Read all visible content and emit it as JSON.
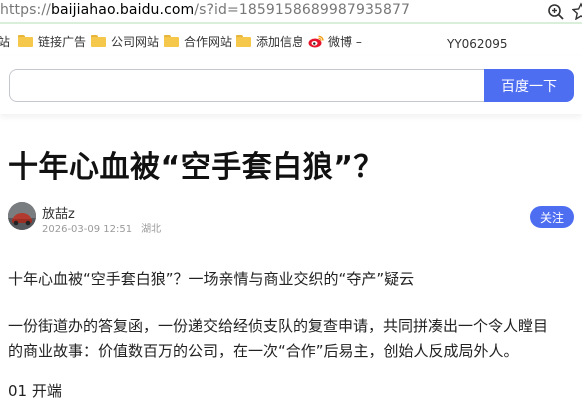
{
  "address_bar": {
    "scheme": "https://",
    "host": "baijiahao.baidu.com",
    "path": "/s?id=1859158689987935877"
  },
  "bookmarks": {
    "items": [
      {
        "label": "站",
        "icon": "folder-icon"
      },
      {
        "label": "链接广告",
        "icon": "folder-icon"
      },
      {
        "label": "公司网站",
        "icon": "folder-icon"
      },
      {
        "label": "合作网站",
        "icon": "folder-icon"
      },
      {
        "label": "添加信息",
        "icon": "folder-icon"
      },
      {
        "label": "微博 –",
        "icon": "weibo-icon"
      }
    ],
    "extra_label": "YY062095"
  },
  "search": {
    "input_value": "",
    "button_label": "百度一下"
  },
  "article": {
    "title": "十年心血被“空手套白狼”？",
    "author": "放喆z",
    "date": "2026-03-09 12:51",
    "location": "湖北",
    "follow_label": "关注",
    "paragraphs": [
      "十年心血被“空手套白狼”？一场亲情与商业交织的“夺产”疑云",
      "一份街道办的答复函，一份递交给经侦支队的复查申请，共同拼凑出一个令人瞠目",
      "的商业故事：价值数百万的公司，在一次“合作”后易主，创始人反成局外人。"
    ],
    "section_heading": "01 开端"
  },
  "colors": {
    "accent": "#4e6ef2",
    "folder": "#f5c84c",
    "weibo": "#e6162d"
  }
}
